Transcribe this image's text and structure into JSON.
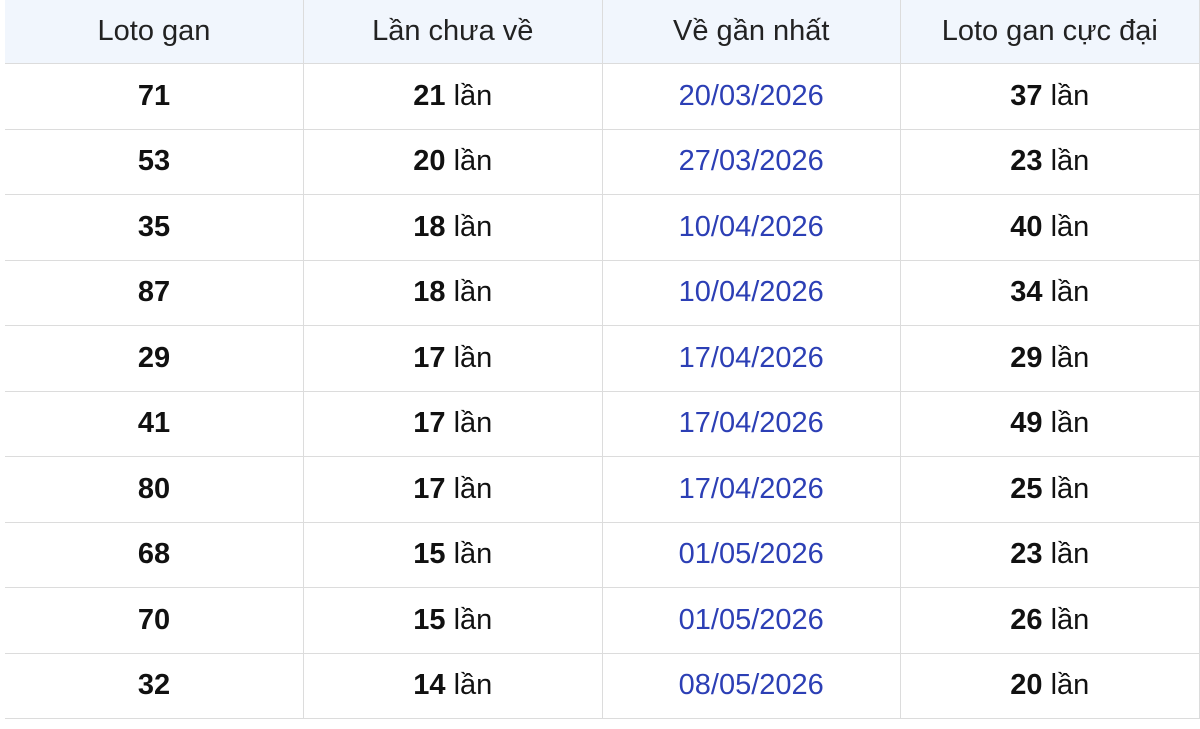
{
  "table": {
    "headers": [
      "Loto gan",
      "Lần chưa về",
      "Về gần nhất",
      "Loto gan cực đại"
    ],
    "rows": [
      {
        "loto": "71",
        "misses": "21",
        "misses_unit": "lần",
        "last_seen": "20/03/2026",
        "max": "37",
        "max_unit": "lần"
      },
      {
        "loto": "53",
        "misses": "20",
        "misses_unit": "lần",
        "last_seen": "27/03/2026",
        "max": "23",
        "max_unit": "lần"
      },
      {
        "loto": "35",
        "misses": "18",
        "misses_unit": "lần",
        "last_seen": "10/04/2026",
        "max": "40",
        "max_unit": "lần"
      },
      {
        "loto": "87",
        "misses": "18",
        "misses_unit": "lần",
        "last_seen": "10/04/2026",
        "max": "34",
        "max_unit": "lần"
      },
      {
        "loto": "29",
        "misses": "17",
        "misses_unit": "lần",
        "last_seen": "17/04/2026",
        "max": "29",
        "max_unit": "lần"
      },
      {
        "loto": "41",
        "misses": "17",
        "misses_unit": "lần",
        "last_seen": "17/04/2026",
        "max": "49",
        "max_unit": "lần"
      },
      {
        "loto": "80",
        "misses": "17",
        "misses_unit": "lần",
        "last_seen": "17/04/2026",
        "max": "25",
        "max_unit": "lần"
      },
      {
        "loto": "68",
        "misses": "15",
        "misses_unit": "lần",
        "last_seen": "01/05/2026",
        "max": "23",
        "max_unit": "lần"
      },
      {
        "loto": "70",
        "misses": "15",
        "misses_unit": "lần",
        "last_seen": "01/05/2026",
        "max": "26",
        "max_unit": "lần"
      },
      {
        "loto": "32",
        "misses": "14",
        "misses_unit": "lần",
        "last_seen": "08/05/2026",
        "max": "20",
        "max_unit": "lần"
      }
    ]
  },
  "colors": {
    "header_bg": "#f1f6fd",
    "border": "#dcdcdc",
    "date_link": "#2c3fb5",
    "text": "#111111"
  }
}
